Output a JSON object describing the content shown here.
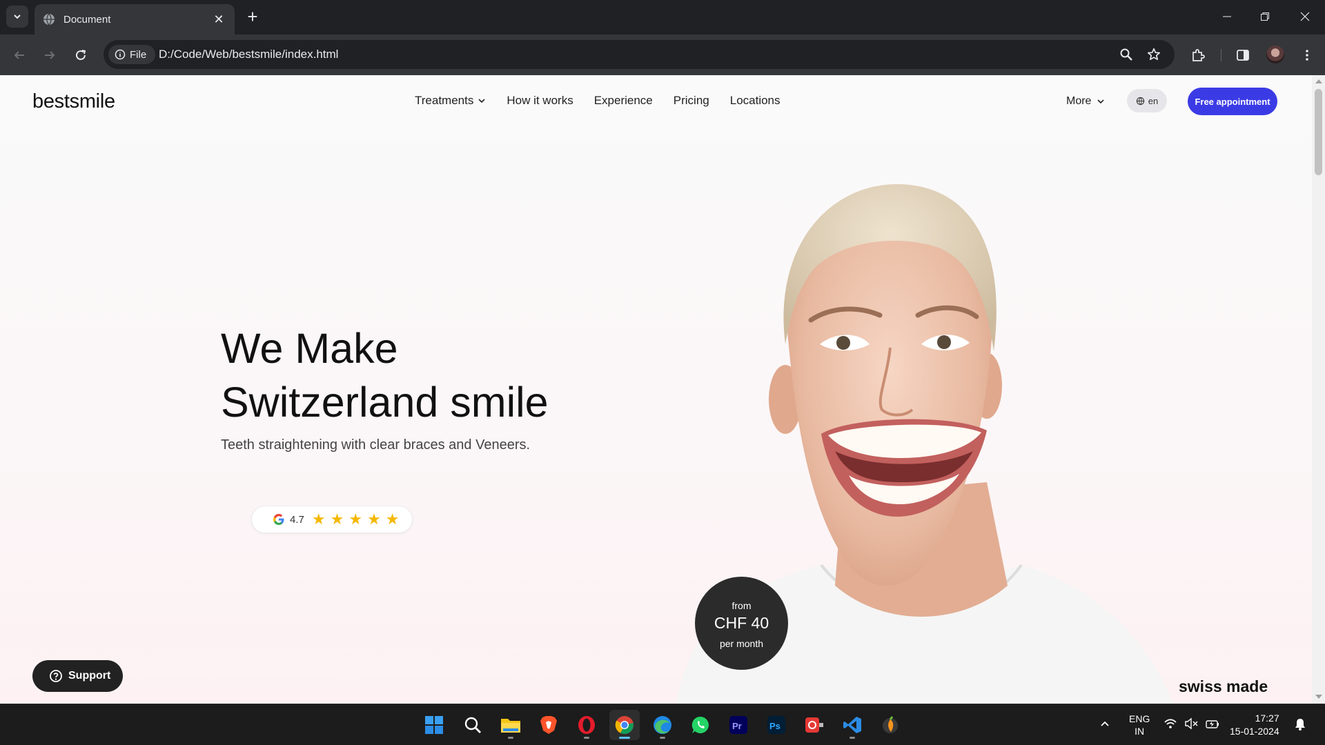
{
  "browser": {
    "tab_title": "Document",
    "new_tab": "+",
    "close_tab": "✕",
    "site_info_label": "File",
    "url": "D:/Code/Web/bestsmile/index.html"
  },
  "site": {
    "logo": "bestsmile",
    "nav": [
      "Treatments",
      "How it works",
      "Experience",
      "Pricing",
      "Locations"
    ],
    "more": "More",
    "lang": "en",
    "cta": "Free appointment"
  },
  "hero": {
    "title_line1": "We Make",
    "title_line2": "Switzerland smile",
    "subtitle": "Teeth straightening with clear braces and Veneers.",
    "rating": "4.7",
    "stars": 5
  },
  "price_badge": {
    "from": "from",
    "amount": "CHF 40",
    "per": "per month"
  },
  "support_label": "Support",
  "swiss_made": "swiss made",
  "taskbar": {
    "apps": [
      "start-icon",
      "search-icon",
      "file-explorer-icon",
      "brave-icon",
      "opera-icon",
      "chrome-icon",
      "edge-icon",
      "whatsapp-icon",
      "premiere-icon",
      "photoshop-icon",
      "screen-recorder-icon",
      "vscode-icon",
      "fl-studio-icon"
    ],
    "lang_line1": "ENG",
    "lang_line2": "IN",
    "time": "17:27",
    "date": "15-01-2024"
  },
  "colors": {
    "cta": "#3b3be6",
    "badge": "#2b2b2b",
    "star": "#f5b800"
  }
}
